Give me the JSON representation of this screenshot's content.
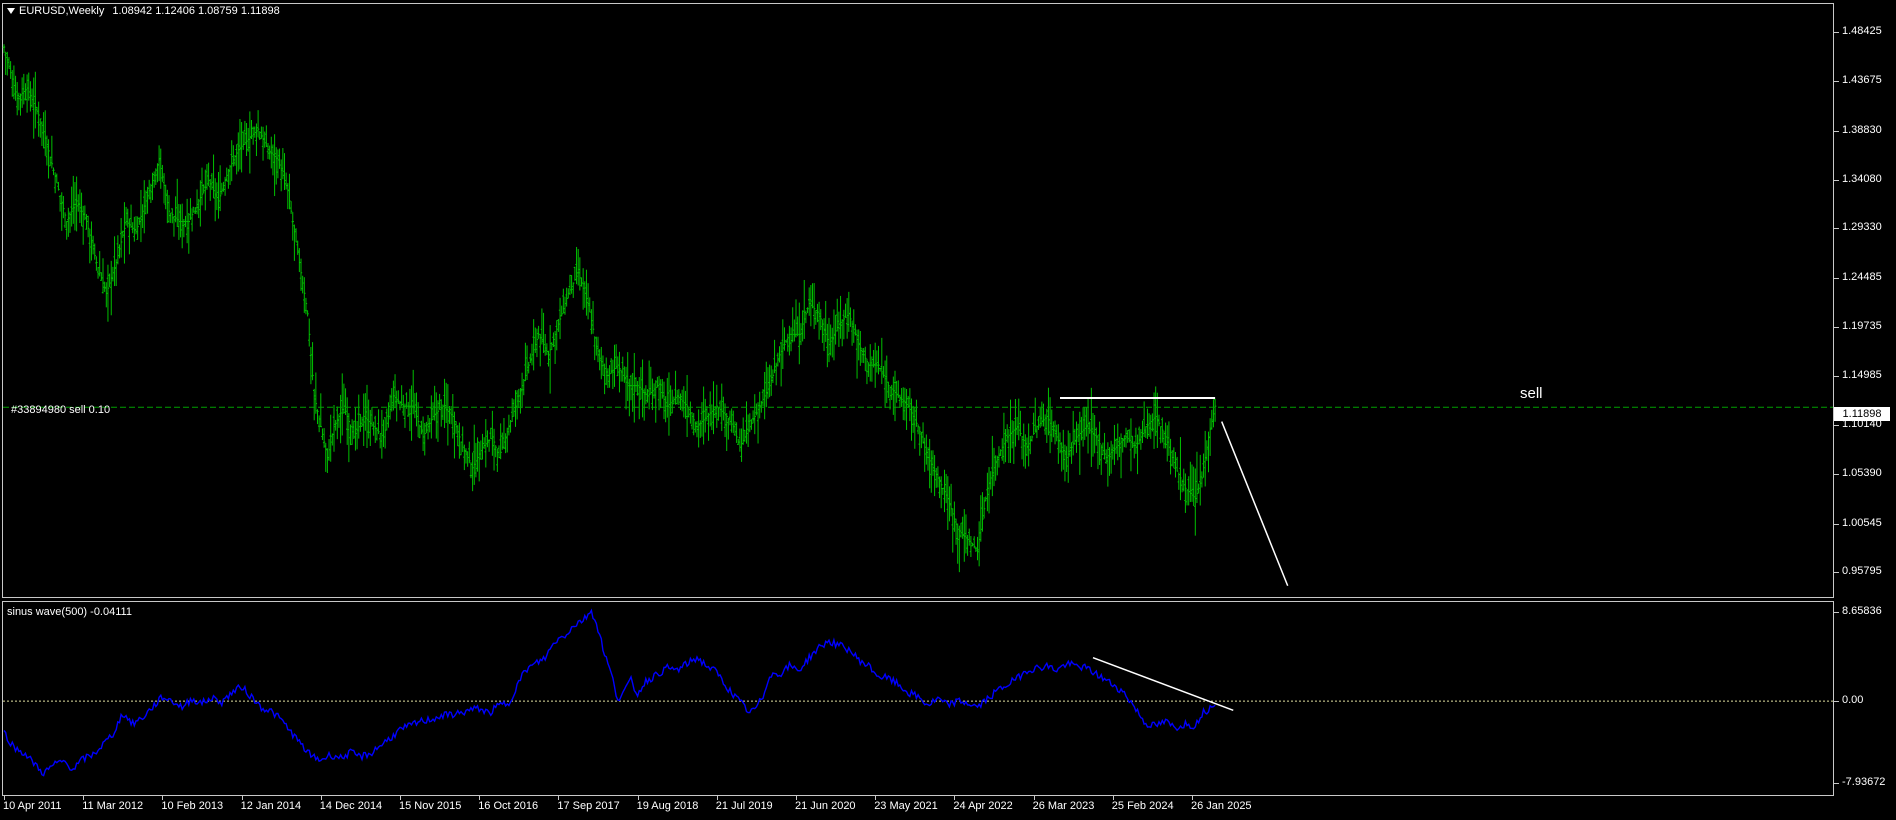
{
  "header": {
    "symbol": "EURUSD,Weekly",
    "ohlc": "1.08942 1.12406 1.08759 1.11898"
  },
  "indicator": {
    "label": "sinus wave(500) -0.04111"
  },
  "order": {
    "label": "#33894980 sell 0.10",
    "price": "1.11898"
  },
  "annotation": {
    "sell_text": "sell"
  },
  "colors": {
    "background": "#000000",
    "candles": "#00c000",
    "indicator_line": "#0000ff",
    "order_line": "#00a000",
    "annotation": "#ffffff"
  },
  "chart_data": [
    {
      "type": "bar",
      "symbol": "EURUSD",
      "timeframe": "Weekly",
      "y_ticks": [
        "1.48425",
        "1.43675",
        "1.38830",
        "1.34080",
        "1.29330",
        "1.24485",
        "1.19735",
        "1.14985",
        "1.10140",
        "1.05390",
        "1.00545",
        "0.95795"
      ],
      "ylim": [
        0.935,
        1.51
      ],
      "x_ticks": [
        "10 Apr 2011",
        "11 Mar 2012",
        "10 Feb 2013",
        "12 Jan 2014",
        "14 Dec 2014",
        "15 Nov 2015",
        "16 Oct 2016",
        "17 Sep 2017",
        "19 Aug 2018",
        "21 Jul 2019",
        "21 Jun 2020",
        "23 May 2021",
        "24 Apr 2022",
        "26 Mar 2023",
        "25 Feb 2024",
        "26 Jan 2025"
      ],
      "x_tick_index": [
        0,
        48,
        96,
        144,
        192,
        240,
        288,
        336,
        384,
        432,
        480,
        528,
        576,
        624,
        672,
        720
      ],
      "close_path": [
        [
          0,
          1.47
        ],
        [
          8,
          1.42
        ],
        [
          14,
          1.43
        ],
        [
          22,
          1.4
        ],
        [
          30,
          1.35
        ],
        [
          38,
          1.3
        ],
        [
          44,
          1.32
        ],
        [
          50,
          1.3
        ],
        [
          56,
          1.26
        ],
        [
          62,
          1.23
        ],
        [
          68,
          1.26
        ],
        [
          74,
          1.3
        ],
        [
          80,
          1.29
        ],
        [
          88,
          1.33
        ],
        [
          94,
          1.36
        ],
        [
          100,
          1.31
        ],
        [
          106,
          1.3
        ],
        [
          112,
          1.3
        ],
        [
          118,
          1.32
        ],
        [
          124,
          1.34
        ],
        [
          130,
          1.32
        ],
        [
          136,
          1.35
        ],
        [
          142,
          1.37
        ],
        [
          148,
          1.38
        ],
        [
          154,
          1.39
        ],
        [
          160,
          1.37
        ],
        [
          166,
          1.36
        ],
        [
          172,
          1.33
        ],
        [
          178,
          1.27
        ],
        [
          184,
          1.21
        ],
        [
          188,
          1.13
        ],
        [
          192,
          1.1
        ],
        [
          196,
          1.07
        ],
        [
          200,
          1.1
        ],
        [
          206,
          1.12
        ],
        [
          212,
          1.09
        ],
        [
          218,
          1.11
        ],
        [
          224,
          1.1
        ],
        [
          230,
          1.09
        ],
        [
          236,
          1.13
        ],
        [
          242,
          1.12
        ],
        [
          248,
          1.12
        ],
        [
          254,
          1.09
        ],
        [
          260,
          1.11
        ],
        [
          266,
          1.12
        ],
        [
          272,
          1.11
        ],
        [
          278,
          1.08
        ],
        [
          284,
          1.06
        ],
        [
          290,
          1.08
        ],
        [
          296,
          1.09
        ],
        [
          300,
          1.07
        ],
        [
          306,
          1.1
        ],
        [
          312,
          1.13
        ],
        [
          318,
          1.16
        ],
        [
          324,
          1.19
        ],
        [
          330,
          1.17
        ],
        [
          336,
          1.2
        ],
        [
          342,
          1.23
        ],
        [
          348,
          1.25
        ],
        [
          354,
          1.22
        ],
        [
          360,
          1.17
        ],
        [
          366,
          1.15
        ],
        [
          372,
          1.16
        ],
        [
          378,
          1.14
        ],
        [
          384,
          1.14
        ],
        [
          390,
          1.13
        ],
        [
          396,
          1.14
        ],
        [
          402,
          1.12
        ],
        [
          408,
          1.13
        ],
        [
          414,
          1.12
        ],
        [
          420,
          1.1
        ],
        [
          426,
          1.11
        ],
        [
          432,
          1.12
        ],
        [
          438,
          1.11
        ],
        [
          442,
          1.1
        ],
        [
          446,
          1.08
        ],
        [
          452,
          1.1
        ],
        [
          458,
          1.12
        ],
        [
          464,
          1.14
        ],
        [
          470,
          1.17
        ],
        [
          476,
          1.19
        ],
        [
          482,
          1.19
        ],
        [
          488,
          1.22
        ],
        [
          494,
          1.21
        ],
        [
          500,
          1.18
        ],
        [
          506,
          1.2
        ],
        [
          512,
          1.21
        ],
        [
          518,
          1.18
        ],
        [
          524,
          1.16
        ],
        [
          530,
          1.16
        ],
        [
          536,
          1.14
        ],
        [
          542,
          1.13
        ],
        [
          548,
          1.12
        ],
        [
          554,
          1.1
        ],
        [
          560,
          1.07
        ],
        [
          566,
          1.05
        ],
        [
          572,
          1.03
        ],
        [
          578,
          1.0
        ],
        [
          584,
          0.99
        ],
        [
          590,
          0.98
        ],
        [
          596,
          1.04
        ],
        [
          602,
          1.07
        ],
        [
          608,
          1.09
        ],
        [
          614,
          1.1
        ],
        [
          620,
          1.08
        ],
        [
          626,
          1.1
        ],
        [
          632,
          1.11
        ],
        [
          638,
          1.09
        ],
        [
          644,
          1.07
        ],
        [
          650,
          1.09
        ],
        [
          656,
          1.1
        ],
        [
          662,
          1.09
        ],
        [
          668,
          1.07
        ],
        [
          674,
          1.08
        ],
        [
          680,
          1.09
        ],
        [
          686,
          1.08
        ],
        [
          692,
          1.1
        ],
        [
          698,
          1.11
        ],
        [
          704,
          1.09
        ],
        [
          710,
          1.06
        ],
        [
          716,
          1.04
        ],
        [
          722,
          1.03
        ],
        [
          726,
          1.05
        ],
        [
          730,
          1.09
        ],
        [
          734,
          1.12
        ]
      ],
      "order_line_price": 1.11898,
      "resistance_line": {
        "from": [
          640,
          1.128
        ],
        "to": [
          734,
          1.128
        ]
      },
      "projection_line": {
        "from": [
          738,
          1.105
        ],
        "to": [
          778,
          0.945
        ]
      }
    },
    {
      "type": "line",
      "name": "sinus wave(500)",
      "y_ticks": [
        "8.65836",
        "0.00",
        "-7.93672"
      ],
      "ylim": [
        -9.0,
        9.4
      ],
      "zero_level": 0.0,
      "points": [
        [
          0,
          -3.0
        ],
        [
          6,
          -4.5
        ],
        [
          12,
          -5.0
        ],
        [
          18,
          -6.0
        ],
        [
          24,
          -7.0
        ],
        [
          30,
          -6.2
        ],
        [
          36,
          -5.8
        ],
        [
          42,
          -6.6
        ],
        [
          48,
          -5.6
        ],
        [
          54,
          -5.2
        ],
        [
          60,
          -4.2
        ],
        [
          66,
          -3.2
        ],
        [
          72,
          -1.2
        ],
        [
          78,
          -2.2
        ],
        [
          84,
          -1.6
        ],
        [
          90,
          -0.6
        ],
        [
          96,
          0.4
        ],
        [
          102,
          0.0
        ],
        [
          108,
          -0.6
        ],
        [
          114,
          0.2
        ],
        [
          120,
          -0.2
        ],
        [
          126,
          0.3
        ],
        [
          132,
          -0.1
        ],
        [
          138,
          0.8
        ],
        [
          144,
          1.4
        ],
        [
          150,
          0.4
        ],
        [
          156,
          -0.6
        ],
        [
          162,
          -1.0
        ],
        [
          168,
          -1.8
        ],
        [
          174,
          -3.0
        ],
        [
          180,
          -4.2
        ],
        [
          186,
          -5.3
        ],
        [
          192,
          -5.7
        ],
        [
          198,
          -5.2
        ],
        [
          204,
          -5.5
        ],
        [
          210,
          -5.0
        ],
        [
          216,
          -5.4
        ],
        [
          222,
          -5.1
        ],
        [
          228,
          -4.3
        ],
        [
          234,
          -3.6
        ],
        [
          240,
          -2.8
        ],
        [
          246,
          -2.4
        ],
        [
          252,
          -2.0
        ],
        [
          258,
          -1.8
        ],
        [
          264,
          -1.5
        ],
        [
          270,
          -1.3
        ],
        [
          276,
          -1.2
        ],
        [
          282,
          -0.9
        ],
        [
          288,
          -0.7
        ],
        [
          294,
          -1.2
        ],
        [
          300,
          -0.4
        ],
        [
          306,
          -0.2
        ],
        [
          310,
          1.2
        ],
        [
          316,
          3.0
        ],
        [
          322,
          3.6
        ],
        [
          328,
          4.2
        ],
        [
          334,
          5.8
        ],
        [
          340,
          6.4
        ],
        [
          346,
          7.4
        ],
        [
          352,
          8.0
        ],
        [
          356,
          8.8
        ],
        [
          360,
          7.0
        ],
        [
          364,
          4.6
        ],
        [
          368,
          2.6
        ],
        [
          372,
          0.2
        ],
        [
          376,
          1.0
        ],
        [
          380,
          2.0
        ],
        [
          384,
          0.6
        ],
        [
          388,
          1.8
        ],
        [
          392,
          2.2
        ],
        [
          396,
          2.6
        ],
        [
          402,
          3.2
        ],
        [
          408,
          3.0
        ],
        [
          414,
          3.6
        ],
        [
          420,
          4.2
        ],
        [
          426,
          3.4
        ],
        [
          432,
          2.8
        ],
        [
          436,
          1.8
        ],
        [
          442,
          0.6
        ],
        [
          448,
          -0.4
        ],
        [
          452,
          -1.2
        ],
        [
          456,
          -0.6
        ],
        [
          460,
          0.4
        ],
        [
          464,
          2.6
        ],
        [
          470,
          2.6
        ],
        [
          476,
          3.4
        ],
        [
          482,
          3.0
        ],
        [
          488,
          4.2
        ],
        [
          494,
          5.2
        ],
        [
          500,
          5.8
        ],
        [
          506,
          5.4
        ],
        [
          512,
          5.0
        ],
        [
          518,
          4.0
        ],
        [
          524,
          3.4
        ],
        [
          530,
          2.4
        ],
        [
          536,
          2.2
        ],
        [
          542,
          1.6
        ],
        [
          548,
          0.8
        ],
        [
          554,
          0.4
        ],
        [
          560,
          -0.4
        ],
        [
          566,
          0.2
        ],
        [
          572,
          -0.4
        ],
        [
          578,
          0.0
        ],
        [
          584,
          -0.2
        ],
        [
          590,
          -0.6
        ],
        [
          596,
          0.2
        ],
        [
          602,
          1.0
        ],
        [
          608,
          1.6
        ],
        [
          614,
          2.2
        ],
        [
          620,
          3.0
        ],
        [
          626,
          3.2
        ],
        [
          632,
          3.4
        ],
        [
          638,
          3.0
        ],
        [
          644,
          3.6
        ],
        [
          650,
          3.4
        ],
        [
          656,
          3.2
        ],
        [
          662,
          2.6
        ],
        [
          668,
          2.0
        ],
        [
          674,
          1.4
        ],
        [
          680,
          0.6
        ],
        [
          686,
          -0.8
        ],
        [
          692,
          -2.2
        ],
        [
          698,
          -2.4
        ],
        [
          704,
          -2.0
        ],
        [
          710,
          -2.6
        ],
        [
          716,
          -2.2
        ],
        [
          722,
          -2.4
        ],
        [
          726,
          -1.2
        ],
        [
          730,
          -0.8
        ],
        [
          734,
          -0.04
        ]
      ],
      "trend_line": {
        "from": [
          660,
          4.2
        ],
        "to": [
          745,
          -0.9
        ]
      }
    }
  ]
}
